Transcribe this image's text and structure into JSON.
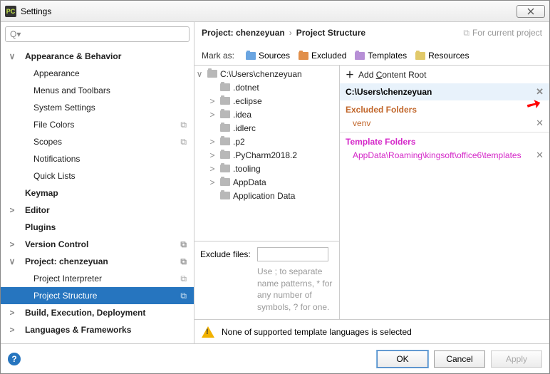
{
  "window": {
    "title": "Settings"
  },
  "search": {
    "placeholder": "Q▾"
  },
  "sidebar": {
    "items": [
      {
        "label": "Appearance & Behavior",
        "bold": true,
        "indent": 1,
        "exp": "∨"
      },
      {
        "label": "Appearance",
        "indent": 2
      },
      {
        "label": "Menus and Toolbars",
        "indent": 2
      },
      {
        "label": "System Settings",
        "indent": 2,
        "exp": ">"
      },
      {
        "label": "File Colors",
        "indent": 2,
        "copy": true
      },
      {
        "label": "Scopes",
        "indent": 2,
        "copy": true
      },
      {
        "label": "Notifications",
        "indent": 2
      },
      {
        "label": "Quick Lists",
        "indent": 2
      },
      {
        "label": "Keymap",
        "bold": true,
        "indent": 1
      },
      {
        "label": "Editor",
        "bold": true,
        "indent": 1,
        "exp": ">"
      },
      {
        "label": "Plugins",
        "bold": true,
        "indent": 1
      },
      {
        "label": "Version Control",
        "bold": true,
        "indent": 1,
        "exp": ">",
        "copy": true
      },
      {
        "label": "Project: chenzeyuan",
        "bold": true,
        "indent": 1,
        "exp": "∨",
        "copy": true
      },
      {
        "label": "Project Interpreter",
        "indent": 2,
        "copy": true
      },
      {
        "label": "Project Structure",
        "indent": 2,
        "selected": true,
        "copy": true
      },
      {
        "label": "Build, Execution, Deployment",
        "bold": true,
        "indent": 1,
        "exp": ">"
      },
      {
        "label": "Languages & Frameworks",
        "bold": true,
        "indent": 1,
        "exp": ">"
      }
    ]
  },
  "breadcrumb": {
    "project": "Project: chenzeyuan",
    "page": "Project Structure",
    "hint": "For current project"
  },
  "markas": {
    "label": "Mark as:",
    "items": [
      "Sources",
      "Excluded",
      "Templates",
      "Resources"
    ]
  },
  "dirtree": {
    "root": "C:\\Users\\chenzeyuan",
    "children": [
      {
        "name": ".dotnet",
        "exp": ""
      },
      {
        "name": ".eclipse",
        "exp": ">"
      },
      {
        "name": ".idea",
        "exp": ">"
      },
      {
        "name": ".idlerc",
        "exp": ""
      },
      {
        "name": ".p2",
        "exp": ">"
      },
      {
        "name": ".PyCharm2018.2",
        "exp": ">"
      },
      {
        "name": ".tooling",
        "exp": ">"
      },
      {
        "name": "AppData",
        "exp": ">"
      },
      {
        "name": "Application Data",
        "exp": ""
      }
    ]
  },
  "excludeFiles": {
    "label": "Exclude files:",
    "help": "Use ; to separate name patterns, * for any number of symbols, ? for one."
  },
  "rightcol": {
    "addRootLabel": "Add Content Root",
    "addRootAccess": "C",
    "contentRoot": "C:\\Users\\chenzeyuan",
    "excludedTitle": "Excluded Folders",
    "excludedItems": [
      "venv"
    ],
    "templateTitle": "Template Folders",
    "templateItems": [
      "AppData\\Roaming\\kingsoft\\office6\\templates"
    ]
  },
  "warning": "None of supported template languages is selected",
  "footer": {
    "ok": "OK",
    "cancel": "Cancel",
    "apply": "Apply"
  }
}
